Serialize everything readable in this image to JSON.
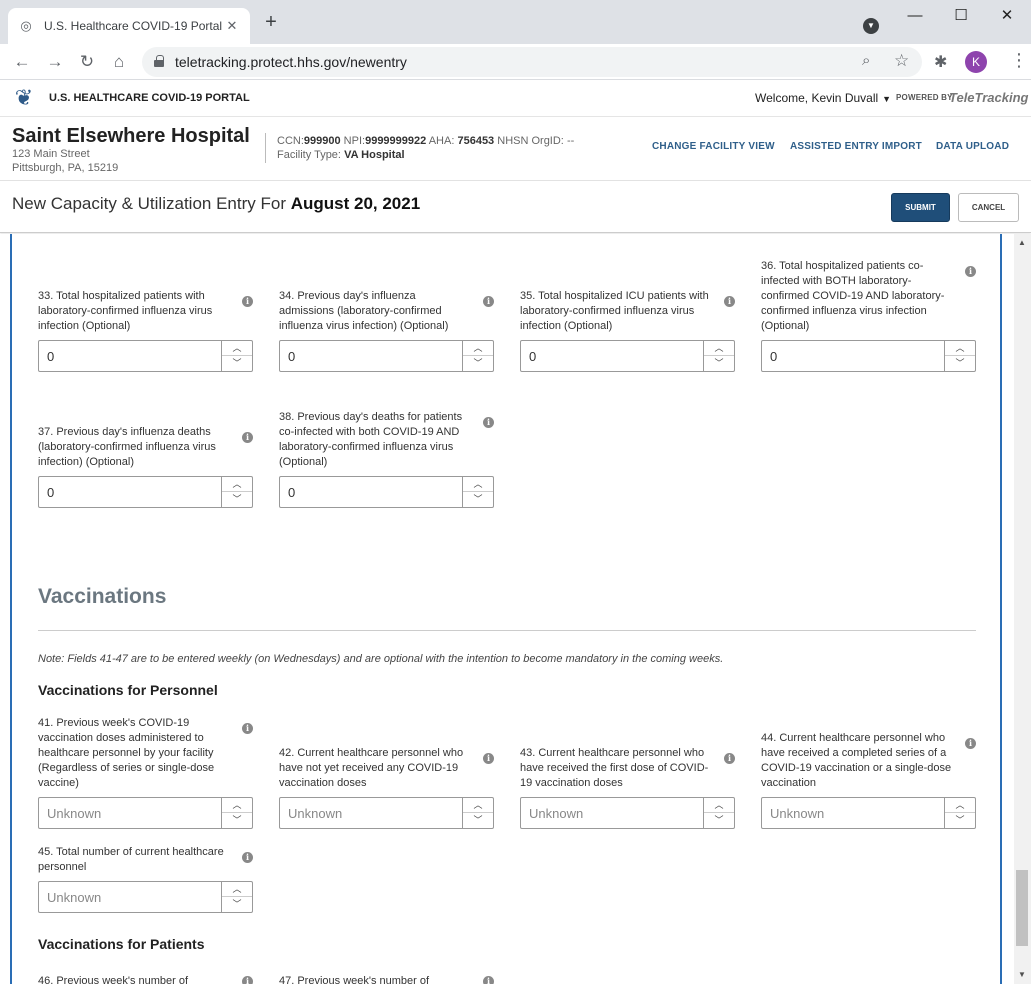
{
  "browser": {
    "tab_title": "U.S. Healthcare COVID-19 Portal",
    "url": "teletracking.protect.hhs.gov/newentry",
    "profile_initial": "K"
  },
  "app": {
    "portal_name": "U.S. HEALTHCARE COVID-19 PORTAL",
    "welcome": "Welcome, Kevin Duvall",
    "powered_by": "POWERED BY",
    "brand": "TeleTracking"
  },
  "facility": {
    "name": "Saint Elsewhere Hospital",
    "address_line1": "123 Main Street",
    "address_line2": "Pittsburgh, PA, 15219",
    "ccn_label": "CCN:",
    "ccn": "999900",
    "npi_label": "NPI:",
    "npi": "9999999922",
    "aha_label": "AHA:",
    "aha": "756453",
    "nhsn_label": "NHSN OrgID:",
    "nhsn": "--",
    "type_label": "Facility Type:",
    "type": "VA Hospital",
    "links": [
      "CHANGE FACILITY VIEW",
      "ASSISTED ENTRY IMPORT",
      "DATA UPLOAD"
    ]
  },
  "entry": {
    "title_prefix": "New Capacity & Utilization Entry For",
    "date": "August 20, 2021",
    "submit_label": "SUBMIT",
    "cancel_label": "CANCEL"
  },
  "influenza_fields": [
    {
      "label": "33. Total hospitalized patients with laboratory-confirmed influenza virus infection (Optional)",
      "value": "0"
    },
    {
      "label": "34. Previous day's influenza admissions (laboratory-confirmed influenza virus infection) (Optional)",
      "value": "0"
    },
    {
      "label": "35. Total hospitalized ICU patients with laboratory-confirmed influenza virus infection (Optional)",
      "value": "0"
    },
    {
      "label": "36. Total hospitalized patients co-infected with BOTH laboratory-confirmed COVID-19 AND laboratory-confirmed influenza virus infection (Optional)",
      "value": "0"
    },
    {
      "label": "37. Previous day's influenza deaths (laboratory-confirmed influenza virus infection) (Optional)",
      "value": "0"
    },
    {
      "label": "38. Previous day's deaths for patients co-infected with both COVID-19 AND laboratory-confirmed influenza virus (Optional)",
      "value": "0"
    }
  ],
  "vaccinations": {
    "title": "Vaccinations",
    "note": "Note: Fields 41-47 are to be entered weekly (on Wednesdays) and are optional with the intention to become mandatory in the coming weeks.",
    "personnel_heading": "Vaccinations for Personnel",
    "personnel_fields": [
      {
        "label": "41. Previous week's COVID-19 vaccination doses administered to healthcare personnel by your facility (Regardless of series or single-dose vaccine)",
        "placeholder": "Unknown"
      },
      {
        "label": "42. Current healthcare personnel who have not yet received any COVID-19 vaccination doses",
        "placeholder": "Unknown"
      },
      {
        "label": "43. Current healthcare personnel who have received the first dose of COVID-19 vaccination doses",
        "placeholder": "Unknown"
      },
      {
        "label": "44. Current healthcare personnel who have received a completed series of a COVID-19 vaccination or a single-dose vaccination",
        "placeholder": "Unknown"
      },
      {
        "label": "45. Total number of current healthcare personnel",
        "placeholder": "Unknown"
      }
    ],
    "patients_heading": "Vaccinations for Patients",
    "patients_partial": [
      "46. Previous week's number of",
      "47. Previous week's number of"
    ]
  }
}
